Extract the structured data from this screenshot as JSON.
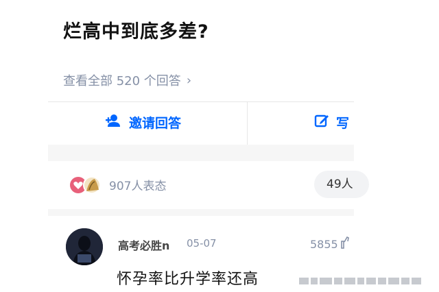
{
  "question": {
    "title": "烂高中到底多差?",
    "view_all_label": "查看全部 520 个回答"
  },
  "actions": {
    "invite_label": "邀请回答",
    "write_label": "写"
  },
  "reactions": {
    "count_label": "907人表态",
    "comment_pill": "49人"
  },
  "answer": {
    "author": "高考必胜n",
    "date": "05-07",
    "likes": "5855",
    "text": "怀孕率比升学率还高"
  },
  "colors": {
    "accent": "#0066ff",
    "muted": "#8590a6",
    "reaction_pink": "#e8607a",
    "reaction_gold": "#c89b4a"
  },
  "icons": [
    "add-user-icon",
    "edit-icon",
    "chevron-right-icon",
    "heart-reaction-icon",
    "trophy-reaction-icon",
    "like-icon"
  ]
}
